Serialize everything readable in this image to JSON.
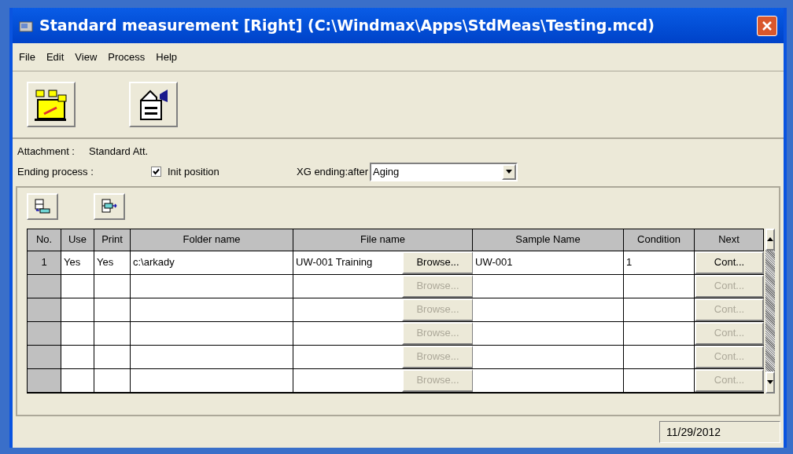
{
  "window": {
    "title": "Standard measurement [Right] (C:\\Windmax\\Apps\\StdMeas\\Testing.mcd)"
  },
  "menu": [
    "File",
    "Edit",
    "View",
    "Process",
    "Help"
  ],
  "form": {
    "attachment_label": "Attachment :",
    "attachment_value": "Standard Att.",
    "ending_label": "Ending process :",
    "init_position": {
      "label": "Init position",
      "checked": true
    },
    "xg_label": "XG ending:after",
    "xg_value": "Aging"
  },
  "table": {
    "columns": [
      "No.",
      "Use",
      "Print",
      "Folder name",
      "File name",
      "Sample Name",
      "Condition",
      "Next"
    ],
    "rows": [
      {
        "no": "1",
        "use": "Yes",
        "print": "Yes",
        "folder": "c:\\arkady",
        "file": "UW-001 Training",
        "browse": {
          "label": "Browse...",
          "disabled": false
        },
        "sample": "UW-001",
        "condition": "1",
        "next": {
          "label": "Cont...",
          "disabled": false
        }
      },
      {
        "browse": {
          "label": "Browse...",
          "disabled": true
        },
        "next": {
          "label": "Cont...",
          "disabled": true
        }
      },
      {
        "browse": {
          "label": "Browse...",
          "disabled": true
        },
        "next": {
          "label": "Cont...",
          "disabled": true
        }
      },
      {
        "browse": {
          "label": "Browse...",
          "disabled": true
        },
        "next": {
          "label": "Cont...",
          "disabled": true
        }
      },
      {
        "browse": {
          "label": "Browse...",
          "disabled": true
        },
        "next": {
          "label": "Cont...",
          "disabled": true
        }
      },
      {
        "browse": {
          "label": "Browse...",
          "disabled": true
        },
        "next": {
          "label": "Cont...",
          "disabled": true
        }
      }
    ]
  },
  "status_bar": {
    "date": "11/29/2012"
  }
}
